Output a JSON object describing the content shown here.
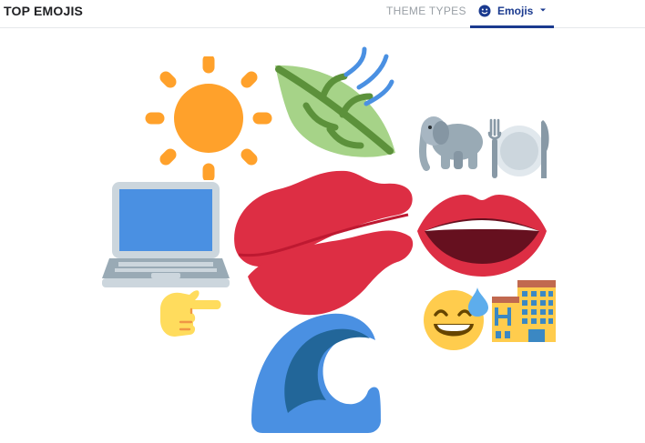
{
  "header": {
    "title": "TOP EMOJIS",
    "tabs": [
      {
        "label": "THEME TYPES",
        "active": false
      },
      {
        "label": "Emojis",
        "active": true,
        "icon": "smiley-icon",
        "dropdown": true
      }
    ]
  },
  "colors": {
    "accent": "#1a3a8f",
    "muted_tab": "#9aa0a6",
    "divider": "#e6e8eb"
  },
  "emoji_cloud": [
    {
      "name": "sun",
      "icon": "sun-icon"
    },
    {
      "name": "leaf fluttering in wind",
      "icon": "leaf-wind-icon"
    },
    {
      "name": "elephant",
      "icon": "elephant-icon"
    },
    {
      "name": "fork and knife with plate",
      "icon": "fork-knife-plate-icon"
    },
    {
      "name": "laptop",
      "icon": "laptop-icon"
    },
    {
      "name": "kiss mark",
      "icon": "kiss-mark-icon"
    },
    {
      "name": "mouth",
      "icon": "mouth-icon"
    },
    {
      "name": "backhand index pointing right",
      "icon": "pointing-right-icon"
    },
    {
      "name": "grinning face with sweat",
      "icon": "sweat-smile-icon"
    },
    {
      "name": "hotel",
      "icon": "hotel-icon"
    },
    {
      "name": "water wave",
      "icon": "water-wave-icon"
    }
  ]
}
